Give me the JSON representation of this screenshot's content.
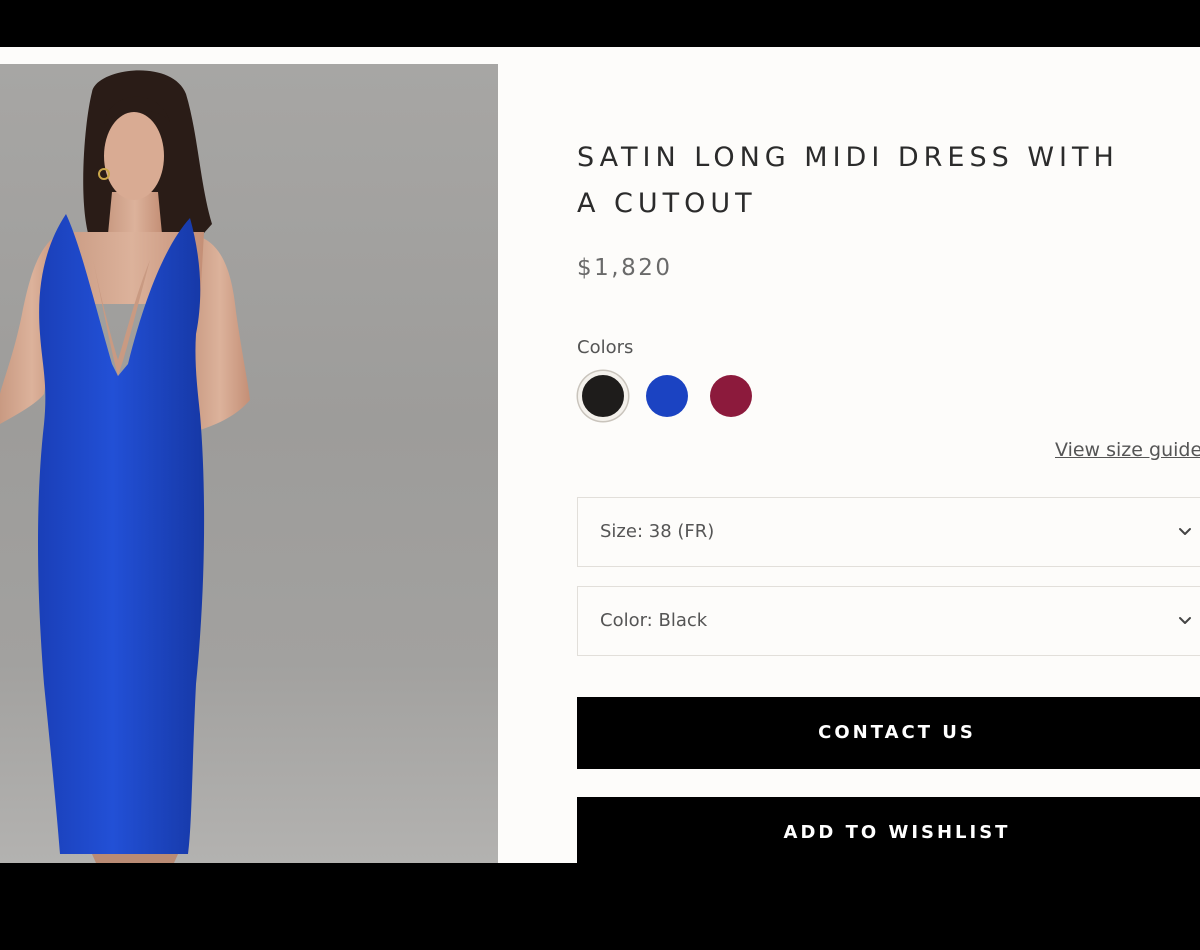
{
  "product": {
    "title": "SATIN LONG MIDI DRESS WITH\nA CUTOUT",
    "price": "$1,820"
  },
  "colors": {
    "label": "Colors",
    "swatches": [
      {
        "name": "Black",
        "hex": "#1e1c1b",
        "selected": true
      },
      {
        "name": "Blue",
        "hex": "#1b43c2",
        "selected": false
      },
      {
        "name": "Burgundy",
        "hex": "#8c1a3c",
        "selected": false
      }
    ]
  },
  "size_guide": {
    "label": "View size guide"
  },
  "selects": {
    "size": {
      "label": "Size: 38 (FR)",
      "icon": "chevron-down-icon"
    },
    "color": {
      "label": "Color: Black",
      "icon": "chevron-down-icon"
    }
  },
  "buttons": {
    "contact": "CONTACT US",
    "wishlist": "ADD TO WISHLIST"
  },
  "theme": {
    "page_bg": "#fdfcfa",
    "button_bg": "#000000",
    "button_text": "#ffffff",
    "dress_color": "#1f47c8"
  }
}
